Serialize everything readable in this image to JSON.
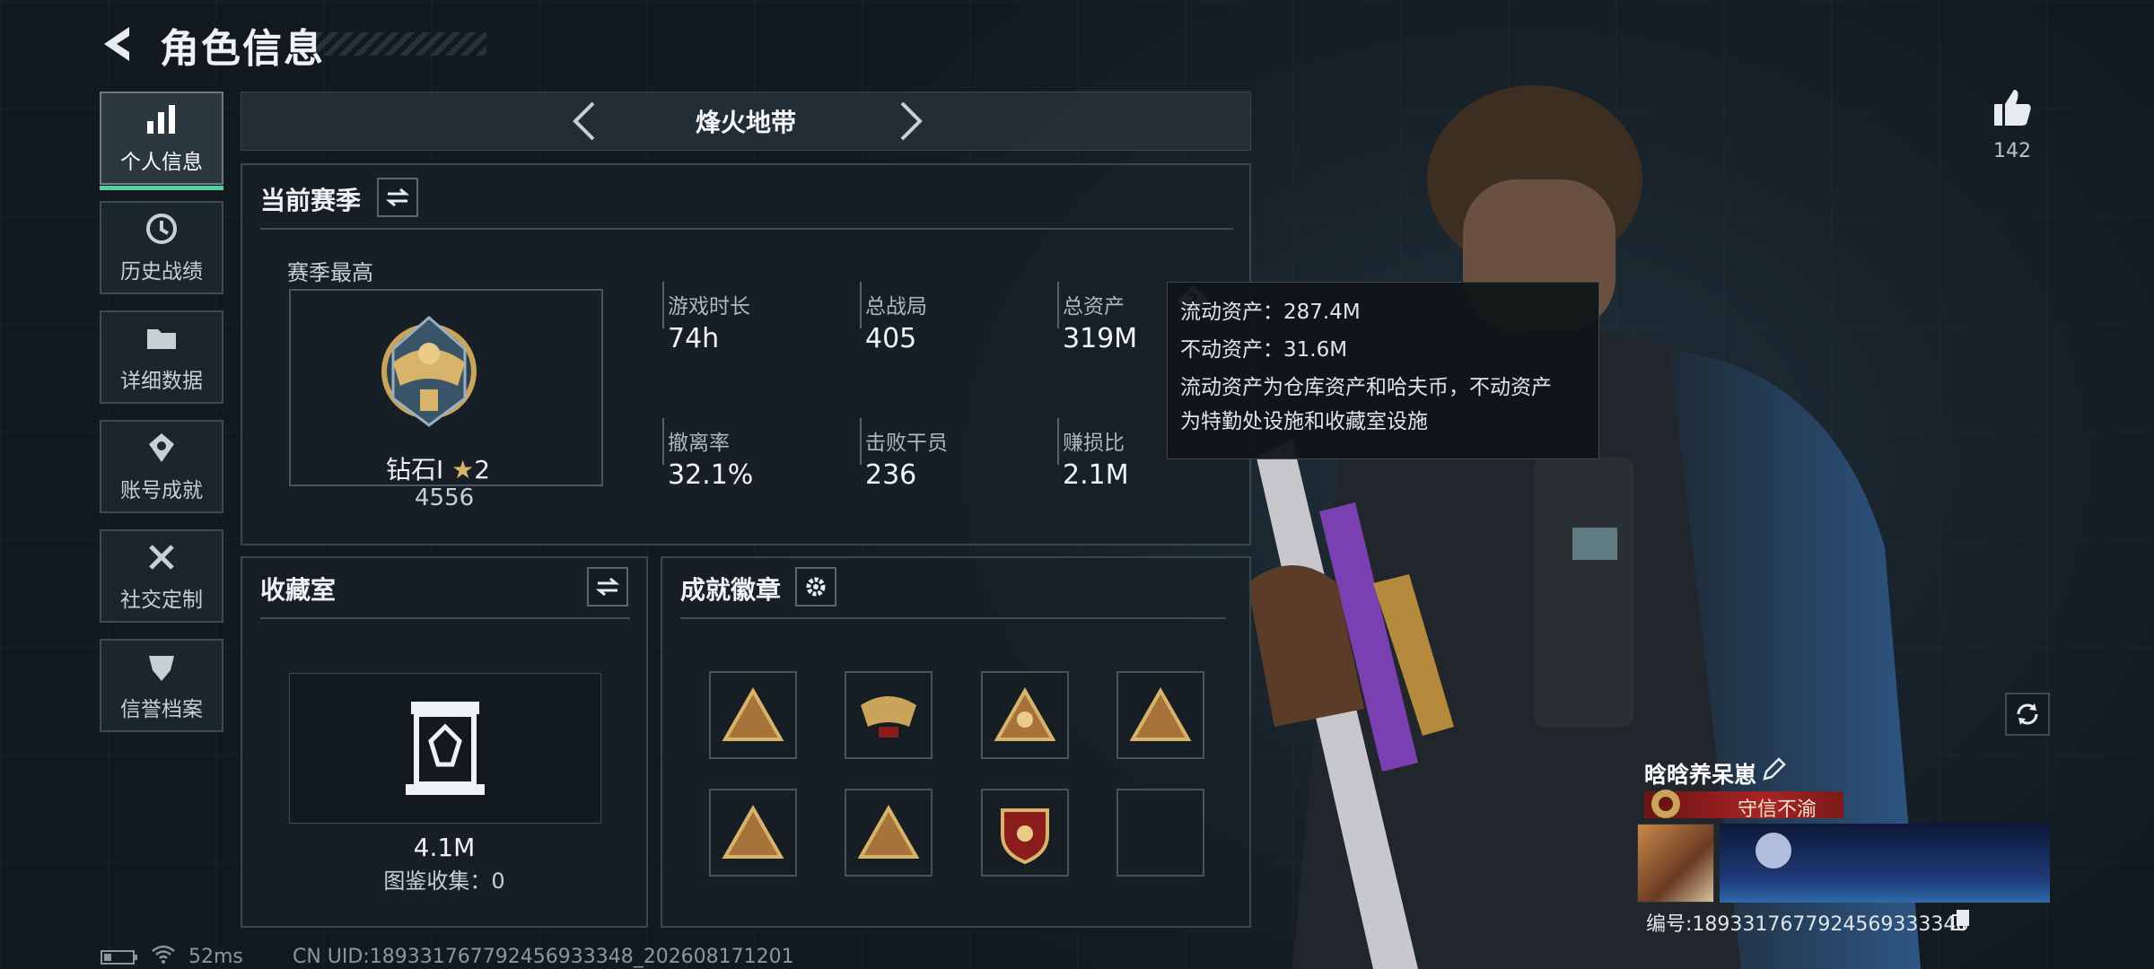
{
  "header": {
    "title": "角色信息"
  },
  "nav": [
    {
      "label": "个人信息",
      "icon": "bar-chart-icon",
      "active": true
    },
    {
      "label": "历史战绩",
      "icon": "history-icon"
    },
    {
      "label": "详细数据",
      "icon": "folder-icon"
    },
    {
      "label": "账号成就",
      "icon": "achievement-icon"
    },
    {
      "label": "社交定制",
      "icon": "tools-icon"
    },
    {
      "label": "信誉档案",
      "icon": "credit-icon"
    }
  ],
  "mode_tabs": {
    "current": "烽火地带"
  },
  "season": {
    "title": "当前赛季",
    "best_label": "赛季最高",
    "rank_name": "钻石Ⅰ",
    "rank_stars": "2",
    "rank_score": "4556",
    "stats": [
      {
        "label": "游戏时长",
        "value": "74h"
      },
      {
        "label": "总战局",
        "value": "405"
      },
      {
        "label": "总资产",
        "value": "319M"
      },
      {
        "label": "撤离率",
        "value": "32.1%"
      },
      {
        "label": "击败干员",
        "value": "236"
      },
      {
        "label": "赚损比",
        "value": "2.1M"
      }
    ]
  },
  "tooltip": {
    "line1": "流动资产：287.4M",
    "line2": "不动资产：31.6M",
    "desc1": "流动资产为仓库资产和哈夫币，不动资产",
    "desc2": "为特勤处设施和收藏室设施"
  },
  "collection": {
    "title": "收藏室",
    "value": "4.1M",
    "catalog": "图鉴收集：0"
  },
  "achievements": {
    "title": "成就徽章"
  },
  "profile": {
    "likes": "142",
    "name": "晗晗养呆崽",
    "title_badge": "守信不渝",
    "id_text": "编号:1893317677924569333348"
  },
  "status_bar": {
    "ping": "52ms",
    "uid": "CN UID:189331767792456933348_202608171201"
  },
  "colors": {
    "accent_green": "#4fd39a",
    "title_red": "#8a1c1c",
    "gold": "#c9a45a"
  }
}
